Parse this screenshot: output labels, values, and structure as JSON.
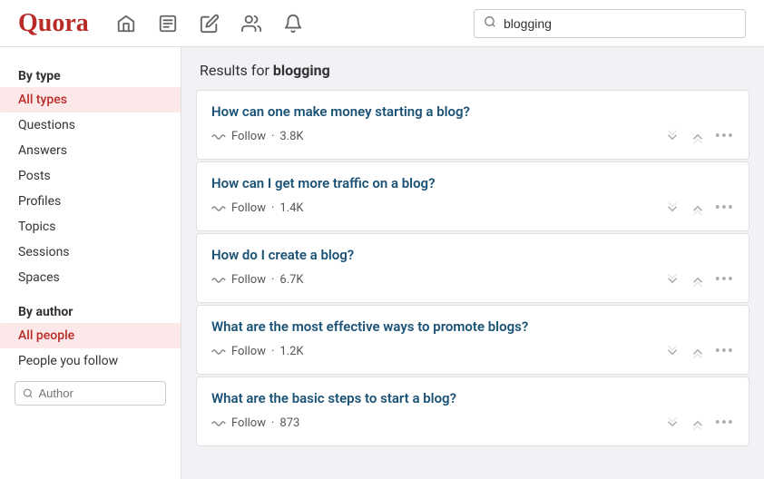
{
  "header": {
    "logo": "Quora",
    "search_placeholder": "blogging",
    "search_value": "blogging"
  },
  "sidebar": {
    "by_type_label": "By type",
    "items_type": [
      {
        "id": "all-types",
        "label": "All types",
        "active": true
      },
      {
        "id": "questions",
        "label": "Questions",
        "active": false
      },
      {
        "id": "answers",
        "label": "Answers",
        "active": false
      },
      {
        "id": "posts",
        "label": "Posts",
        "active": false
      },
      {
        "id": "profiles",
        "label": "Profiles",
        "active": false
      },
      {
        "id": "topics",
        "label": "Topics",
        "active": false
      },
      {
        "id": "sessions",
        "label": "Sessions",
        "active": false
      },
      {
        "id": "spaces",
        "label": "Spaces",
        "active": false
      }
    ],
    "by_author_label": "By author",
    "items_author": [
      {
        "id": "all-people",
        "label": "All people",
        "active": true
      },
      {
        "id": "people-follow",
        "label": "People you follow",
        "active": false
      }
    ],
    "author_input_placeholder": "Author"
  },
  "results": {
    "header_prefix": "Results for ",
    "query": "blogging",
    "items": [
      {
        "id": 1,
        "title": "How can one make money starting a blog?",
        "follow_count": "3.8K"
      },
      {
        "id": 2,
        "title": "How can I get more traffic on a blog?",
        "follow_count": "1.4K"
      },
      {
        "id": 3,
        "title": "How do I create a blog?",
        "follow_count": "6.7K"
      },
      {
        "id": 4,
        "title": "What are the most effective ways to promote blogs?",
        "follow_count": "1.2K"
      },
      {
        "id": 5,
        "title": "What are the basic steps to start a blog?",
        "follow_count": "873"
      }
    ],
    "follow_label": "Follow",
    "follow_dot": "·"
  },
  "nav": {
    "home_icon": "home",
    "feed_icon": "list",
    "write_icon": "pencil",
    "people_icon": "people",
    "bell_icon": "bell"
  }
}
